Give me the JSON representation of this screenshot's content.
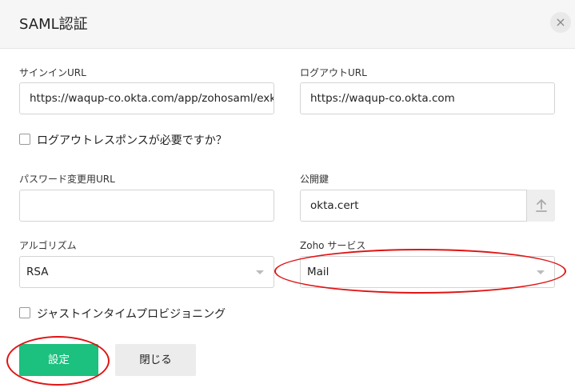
{
  "dialog": {
    "title": "SAML認証",
    "close_label": "×"
  },
  "form": {
    "signin_url": {
      "label": "サインインURL",
      "value": "https://waqup-co.okta.com/app/zohosaml/exk"
    },
    "logout_url": {
      "label": "ログアウトURL",
      "value": "https://waqup-co.okta.com"
    },
    "logout_response_checkbox": {
      "label": "ログアウトレスポンスが必要ですか？",
      "checked": false
    },
    "password_change_url": {
      "label": "パスワード変更用URL",
      "value": ""
    },
    "public_key": {
      "label": "公開鍵",
      "value": "okta.cert",
      "upload_icon": "upload-arrow-icon"
    },
    "algorithm": {
      "label": "アルゴリズム",
      "selected": "RSA"
    },
    "zoho_service": {
      "label": "Zoho サービス",
      "selected": "Mail"
    },
    "jit_checkbox": {
      "label": "ジャストインタイムプロビジョニング",
      "checked": false
    }
  },
  "buttons": {
    "submit": "設定",
    "close": "閉じる"
  },
  "colors": {
    "primary": "#1cc07f",
    "annotation": "#e01414"
  }
}
